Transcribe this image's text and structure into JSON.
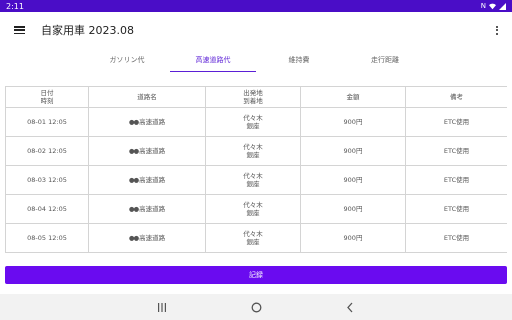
{
  "status_bar": {
    "time": "2:11",
    "icons": [
      "nfc-icon",
      "wifi-icon",
      "signal-icon"
    ]
  },
  "app_bar": {
    "title": "自家用車 2023.08",
    "menu_icon": "hamburger-menu-icon",
    "more_icon": "more-vert-icon"
  },
  "tabs": [
    {
      "label": "ガソリン代",
      "active": false
    },
    {
      "label": "高速道路代",
      "active": true
    },
    {
      "label": "維持費",
      "active": false
    },
    {
      "label": "走行距離",
      "active": false
    }
  ],
  "table": {
    "headers": {
      "datetime": [
        "日付",
        "時刻"
      ],
      "route": "道路名",
      "place": [
        "出発地",
        "到着地"
      ],
      "amount": "金額",
      "note": "備考"
    },
    "rows": [
      {
        "date": "08-01 12:05",
        "route": "高速道路",
        "from": "代々木",
        "to": "銀座",
        "amount": "900円",
        "note": "ETC使用"
      },
      {
        "date": "08-02 12:05",
        "route": "高速道路",
        "from": "代々木",
        "to": "銀座",
        "amount": "900円",
        "note": "ETC使用"
      },
      {
        "date": "08-03 12:05",
        "route": "高速道路",
        "from": "代々木",
        "to": "銀座",
        "amount": "900円",
        "note": "ETC使用"
      },
      {
        "date": "08-04 12:05",
        "route": "高速道路",
        "from": "代々木",
        "to": "銀座",
        "amount": "900円",
        "note": "ETC使用"
      },
      {
        "date": "08-05 12:05",
        "route": "高速道路",
        "from": "代々木",
        "to": "銀座",
        "amount": "900円",
        "note": "ETC使用"
      }
    ],
    "route_prefix": "●●"
  },
  "record_button": {
    "label": "記録"
  },
  "nav_bar": {
    "icons": [
      "recents-icon",
      "home-icon",
      "back-icon"
    ]
  },
  "colors": {
    "accent": "#5b1fd6",
    "status_bar": "#4a0dc7",
    "button": "#6a0bf0"
  }
}
